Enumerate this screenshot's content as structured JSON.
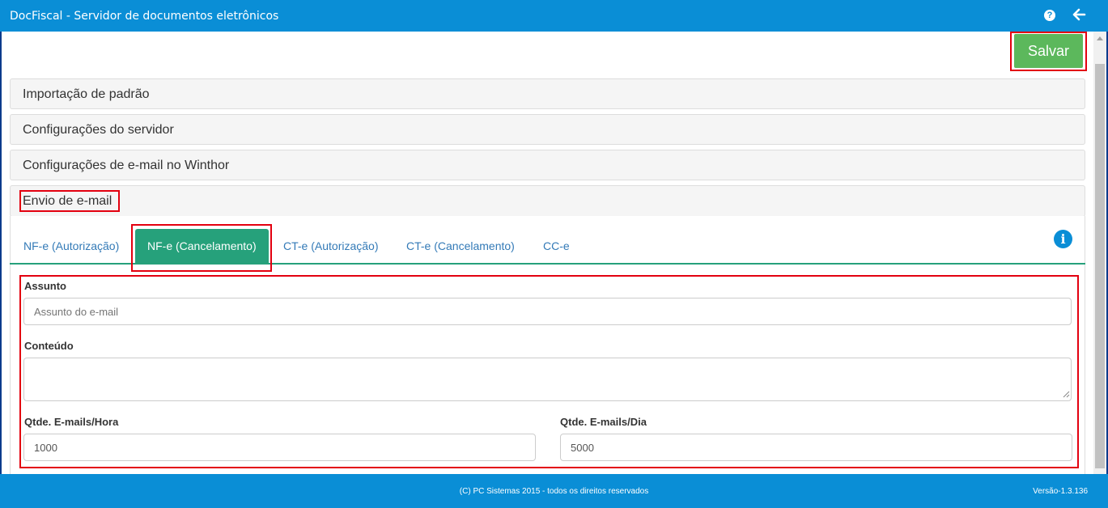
{
  "window": {
    "title": "DocFiscal - Servidor de documentos eletrônicos",
    "help_icon": "?",
    "back_icon": "arrow-left"
  },
  "toolbar": {
    "save_label": "Salvar",
    "save_color": "#5cb85c"
  },
  "panels": [
    {
      "title": "Importação de padrão"
    },
    {
      "title": "Configurações do servidor"
    },
    {
      "title": "Configurações de e-mail no Winthor"
    },
    {
      "title": "Envio de e-mail"
    }
  ],
  "tabs": [
    {
      "label": "NF-e (Autorização)",
      "active": false
    },
    {
      "label": "NF-e (Cancelamento)",
      "active": true
    },
    {
      "label": "CT-e (Autorização)",
      "active": false
    },
    {
      "label": "CT-e (Cancelamento)",
      "active": false
    },
    {
      "label": "CC-e",
      "active": false
    }
  ],
  "form": {
    "assunto_label": "Assunto",
    "assunto_placeholder": "Assunto do e-mail",
    "assunto_value": "",
    "conteudo_label": "Conteúdo",
    "conteudo_value": "",
    "hora_label": "Qtde. E-mails/Hora",
    "hora_value": "1000",
    "dia_label": "Qtde. E-mails/Dia",
    "dia_value": "5000"
  },
  "footer": {
    "copyright": "(C) PC Sistemas 2015 - todos os direitos reservados",
    "version": "Versão-1.3.136"
  },
  "colors": {
    "header": "#0a8ed6",
    "active_tab": "#26a17b",
    "highlight": "#e3000f"
  }
}
